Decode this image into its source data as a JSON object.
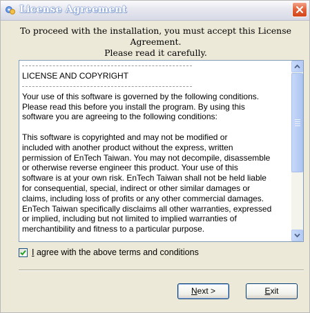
{
  "window": {
    "title": "License Agreement",
    "close_icon": "close-icon",
    "app_icon": "installer-icon"
  },
  "instruction": {
    "line1": "To proceed with the installation, you must accept this License Agreement.",
    "line2": "Please read it carefully."
  },
  "license": {
    "heading": "LICENSE AND COPYRIGHT",
    "para1": "Your use of this software is governed by the following conditions.\nPlease read this before you install the program. By using this\nsoftware you are agreeing to the following conditions:",
    "para2": "This software is copyrighted and may not be modified or\nincluded with another product without the express, written\npermission of EnTech Taiwan. You may not decompile, disassemble\nor otherwise reverse engineer this product. Your use of this\nsoftware is at your own risk. EnTech Taiwan shall not be held liable\nfor consequential, special, indirect or other similar damages or\nclaims, including loss of profits or any other commercial damages.\nEnTech Taiwan specifically disclaims all other warranties, expressed\nor implied, including but not limited to implied warranties of\nmerchantibility and fitness to a particular purpose."
  },
  "agree": {
    "checked": true,
    "mnemonic": "I",
    "label_rest": " agree with the above terms and conditions"
  },
  "buttons": {
    "next_mnemonic": "N",
    "next_rest": "ext >",
    "exit_mnemonic": "E",
    "exit_rest": "xit"
  },
  "colors": {
    "dialog_bg": "#ece9d8",
    "close_red": "#d44519",
    "scroll_blue": "#b8cdf5",
    "check_green": "#21a121"
  }
}
